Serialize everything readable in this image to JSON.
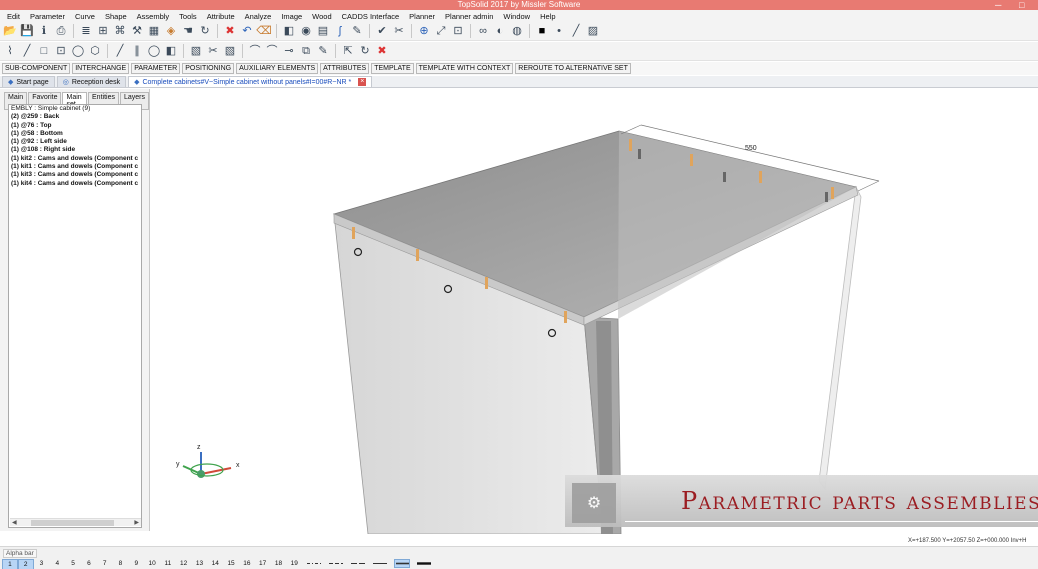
{
  "window": {
    "title": "TopSolid 2017 by Missler Software",
    "minimize": "─",
    "maximize": "□"
  },
  "menu": [
    "Edit",
    "Parameter",
    "Curve",
    "Shape",
    "Assembly",
    "Tools",
    "Attribute",
    "Analyze",
    "Image",
    "Wood",
    "CADDS Interface",
    "Planner",
    "Planner admin",
    "Window",
    "Help"
  ],
  "toolbar1_icons": [
    "open-icon",
    "save-icon",
    "info-icon",
    "print-icon",
    "separator",
    "list-icon",
    "save-as-icon",
    "tree-icon",
    "tools-icon",
    "wood-icon",
    "parts-icon",
    "hand-icon",
    "rotate-icon",
    "separator",
    "delete-icon",
    "undo-icon",
    "eraser-icon",
    "separator",
    "cube-icon",
    "camera-icon",
    "grid-icon",
    "hook-icon",
    "edit-icon",
    "separator",
    "check-icon",
    "cut-icon",
    "separator",
    "zoom-icon",
    "fit-icon",
    "frame-icon",
    "separator",
    "glasses-icon",
    "view-icon",
    "render-icon",
    "separator",
    "color-icon",
    "point-icon",
    "line-icon",
    "pattern-icon"
  ],
  "toolbar2_icons": [
    "polyline-icon",
    "line-icon",
    "rectangle-icon",
    "frame-icon",
    "ellipse-icon",
    "hexagon-icon",
    "separator",
    "line-icon",
    "parallel-icon",
    "ellipse-icon",
    "cube-icon",
    "separator",
    "hatch-icon",
    "cut-icon",
    "hatch-icon",
    "separator",
    "arc-icon",
    "arc-icon",
    "join-icon",
    "copy-icon",
    "edit-icon",
    "separator",
    "stretch-icon",
    "rotate-icon",
    "delete-icon"
  ],
  "context_buttons": [
    "SUB-COMPONENT",
    "INTERCHANGE",
    "PARAMETER",
    "POSITIONING",
    "AUXILIARY ELEMENTS",
    "ATTRIBUTES",
    "TEMPLATE",
    "TEMPLATE WITH CONTEXT",
    "REROUTE TO ALTERNATIVE SET"
  ],
  "doc_tabs": [
    {
      "label": "Start page"
    },
    {
      "label": "Reception desk"
    },
    {
      "label": "Complete cabinets#V~Simple cabinet without panels#I=00#R~NR *"
    }
  ],
  "panel_tabs": [
    "Main",
    "Favorite",
    "Main set",
    "Entities",
    "Layers"
  ],
  "tree": [
    "EMBLY : Simple cabinet (9)",
    "(2) @259 : Back",
    "(1) @76 : Top",
    "(1) @58 : Bottom",
    "(1) @92 : Left side",
    "(1) @108 : Right side",
    "(1) kit2 : Cams and dowels (Component c",
    "(1) kit1 : Cams and dowels (Component c",
    "(1) kit3 : Cams and dowels (Component c",
    "(1) kit4 : Cams and dowels (Component c"
  ],
  "viewport": {
    "dimension": "550",
    "axis": {
      "x": "x",
      "y": "y",
      "z": "z"
    }
  },
  "banner": {
    "text": "Parametric parts assemblies"
  },
  "coords": "X=+187.500  Y=+2057.50  Z=+000.000  Inv+H",
  "alpha_bar": {
    "label": "Alpha bar",
    "pages": [
      "1",
      "2",
      "3",
      "4",
      "5",
      "6",
      "7",
      "8",
      "9",
      "10",
      "11",
      "12",
      "13",
      "14",
      "15",
      "16",
      "17",
      "18",
      "19"
    ]
  }
}
